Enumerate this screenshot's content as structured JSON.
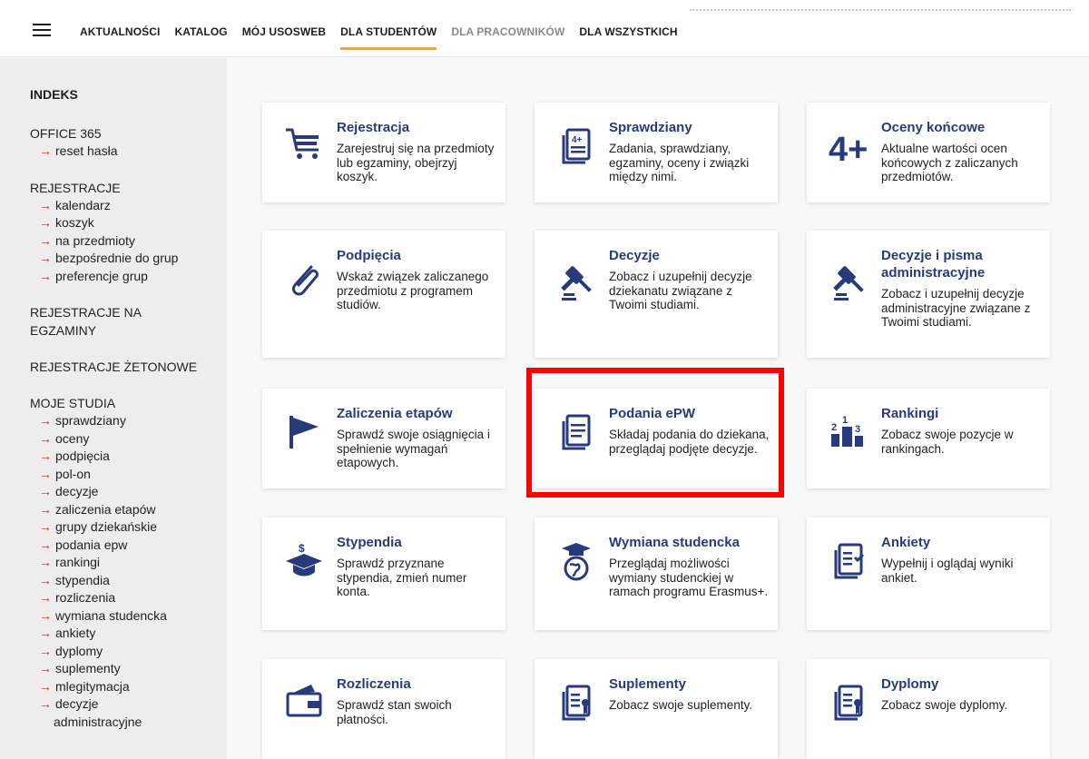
{
  "nav": {
    "items": [
      {
        "label": "AKTUALNOŚCI"
      },
      {
        "label": "KATALOG"
      },
      {
        "label": "MÓJ USOSWEB"
      },
      {
        "label": "DLA STUDENTÓW"
      },
      {
        "label": "DLA PRACOWNIKÓW"
      },
      {
        "label": "DLA WSZYSTKICH"
      }
    ]
  },
  "sidebar": {
    "header": "INDEKS",
    "office": "OFFICE 365",
    "office_links": [
      "reset hasła"
    ],
    "rejestracje": "REJESTRACJE",
    "rejestracje_links": [
      "kalendarz",
      "koszyk",
      "na przedmioty",
      "bezpośrednie do grup",
      "preferencje grup"
    ],
    "rej_egz_1": "REJESTRACJE NA",
    "rej_egz_2": "EGZAMINY",
    "rej_zet": "REJESTRACJE ŻETONOWE",
    "moje": "MOJE STUDIA",
    "moje_links": [
      "sprawdziany",
      "oceny",
      "podpięcia",
      "pol-on",
      "decyzje",
      "zaliczenia etapów",
      "grupy dziekańskie",
      "podania epw",
      "rankingi",
      "stypendia",
      "rozliczenia",
      "wymiana studencka",
      "ankiety",
      "dyplomy",
      "suplementy",
      "mlegitymacja",
      "decyzje"
    ],
    "moje_last_cont": "administracyjne"
  },
  "cards": [
    {
      "title": "Rejestracja",
      "desc": "Zarejestruj się na przedmioty lub egzaminy, obejrzyj koszyk."
    },
    {
      "title": "Sprawdziany",
      "desc": "Zadania, sprawdziany, egzaminy, oceny i związki między nimi."
    },
    {
      "title": "Oceny końcowe",
      "desc": "Aktualne wartości ocen końcowych z zaliczanych przedmiotów."
    },
    {
      "title": "Podpięcia",
      "desc": "Wskaż związek zaliczanego przedmiotu z programem studiów."
    },
    {
      "title": "Decyzje",
      "desc": "Zobacz i uzupełnij decyzje dziekanatu związane z Twoimi studiami."
    },
    {
      "title": "Decyzje i pisma administracyjne",
      "desc": "Zobacz i uzupełnij decyzje administracyjne związane z Twoimi studiami."
    },
    {
      "title": "Zaliczenia etapów",
      "desc": "Sprawdź swoje osiągnięcia i spełnienie wymagań etapowych."
    },
    {
      "title": "Podania ePW",
      "desc": "Składaj podania do dziekana, przeglądaj podjęte decyzje."
    },
    {
      "title": "Rankingi",
      "desc": "Zobacz swoje pozycje w rankingach."
    },
    {
      "title": "Stypendia",
      "desc": "Sprawdź przyznane stypendia, zmień numer konta."
    },
    {
      "title": "Wymiana studencka",
      "desc": "Przeglądaj możliwości wymiany studenckiej w ramach programu Erasmus+."
    },
    {
      "title": "Ankiety",
      "desc": "Wypełnij i oglądaj wyniki ankiet."
    },
    {
      "title": "Rozliczenia",
      "desc": "Sprawdź stan swoich płatności."
    },
    {
      "title": "Suplementy",
      "desc": "Zobacz swoje suplementy."
    },
    {
      "title": "Dyplomy",
      "desc": "Zobacz swoje dyplomy."
    }
  ],
  "icons": {
    "oceny_glyph": "4+",
    "rankings_digits": [
      "2",
      "1",
      "3"
    ],
    "sprawdziany_glyph": "4+",
    "stypendia_glyph": "$"
  },
  "colors": {
    "accent": "#273a7c",
    "nav_underline": "#e9a45a",
    "arrow": "#cf2a2a",
    "highlight": "#ff0000"
  }
}
